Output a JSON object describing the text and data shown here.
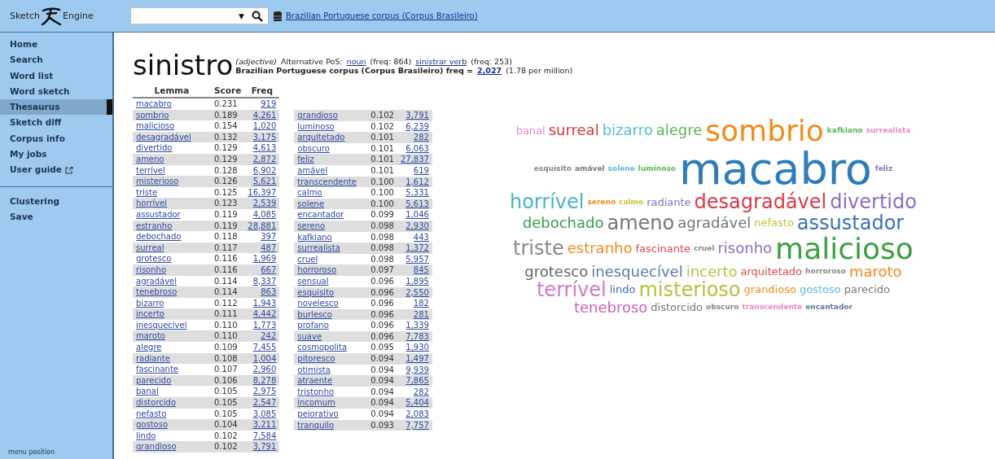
{
  "header": {
    "logo_left": "Sketch",
    "logo_right": "Engine",
    "search": {
      "dropdown": "▼"
    },
    "corpus_link": "Brazilian Portuguese corpus (Corpus Brasileiro)"
  },
  "sidebar": {
    "items": [
      {
        "label": "Home",
        "selected": false
      },
      {
        "label": "Search",
        "selected": false
      },
      {
        "label": "Word list",
        "selected": false
      },
      {
        "label": "Word sketch",
        "selected": false
      },
      {
        "label": "Thesaurus",
        "selected": true
      },
      {
        "label": "Sketch diff",
        "selected": false
      },
      {
        "label": "Corpus info",
        "selected": false
      },
      {
        "label": "My jobs",
        "selected": false
      },
      {
        "label": "User guide",
        "selected": false,
        "external": true
      }
    ],
    "tools": [
      "Clustering",
      "Save"
    ],
    "footer": "menu position"
  },
  "headword": {
    "word": "sinistro",
    "pos": "(adjective)",
    "alt_label": "Alternative PoS:",
    "alt": [
      {
        "link": "noun",
        "freq": "(freq: 864)"
      },
      {
        "link": "sinistrar verb",
        "freq": "(freq: 253)"
      }
    ],
    "corpus_text": "Brazilian Portuguese corpus (Corpus Brasileiro) freq =",
    "freq_link": "2,027",
    "per_million": "(1.78 per million)"
  },
  "table": {
    "columns": [
      "Lemma",
      "Score",
      "Freq"
    ],
    "rows": [
      [
        "macabro",
        "0.231",
        "919"
      ],
      [
        "sombrio",
        "0.189",
        "4,261"
      ],
      [
        "malicioso",
        "0.154",
        "1,020"
      ],
      [
        "desagradável",
        "0.132",
        "3,175"
      ],
      [
        "divertido",
        "0.129",
        "4,613"
      ],
      [
        "ameno",
        "0.129",
        "2,872"
      ],
      [
        "terrível",
        "0.128",
        "6,902"
      ],
      [
        "misterioso",
        "0.126",
        "5,621"
      ],
      [
        "triste",
        "0.125",
        "16,397"
      ],
      [
        "horrível",
        "0.123",
        "2,539"
      ],
      [
        "assustador",
        "0.119",
        "4,085"
      ],
      [
        "estranho",
        "0.119",
        "28,881"
      ],
      [
        "debochado",
        "0.118",
        "397"
      ],
      [
        "surreal",
        "0.117",
        "487"
      ],
      [
        "grotesco",
        "0.116",
        "1,969"
      ],
      [
        "risonho",
        "0.116",
        "667"
      ],
      [
        "agradável",
        "0.114",
        "8,337"
      ],
      [
        "tenebroso",
        "0.114",
        "863"
      ],
      [
        "bizarro",
        "0.112",
        "1,943"
      ],
      [
        "incerto",
        "0.111",
        "4,442"
      ],
      [
        "inesquecível",
        "0.110",
        "1,773"
      ],
      [
        "maroto",
        "0.110",
        "242"
      ],
      [
        "alegre",
        "0.109",
        "7,455"
      ],
      [
        "radiante",
        "0.108",
        "1,004"
      ],
      [
        "fascinante",
        "0.107",
        "2,960"
      ],
      [
        "parecido",
        "0.106",
        "8,278"
      ],
      [
        "banal",
        "0.105",
        "2,975"
      ],
      [
        "distorcido",
        "0.105",
        "2,547"
      ],
      [
        "nefasto",
        "0.105",
        "3,085"
      ],
      [
        "gostoso",
        "0.104",
        "3,211"
      ],
      [
        "lindo",
        "0.102",
        "7,584"
      ],
      [
        "grandioso",
        "0.102",
        "3,791"
      ]
    ],
    "rows_2": [
      [
        "grandioso",
        "0.102",
        "3,791"
      ],
      [
        "luminoso",
        "0.102",
        "6,239"
      ],
      [
        "arquitetado",
        "0.101",
        "282"
      ],
      [
        "obscuro",
        "0.101",
        "6,063"
      ],
      [
        "feliz",
        "0.101",
        "27,837"
      ],
      [
        "amável",
        "0.101",
        "619"
      ],
      [
        "transcendente",
        "0.100",
        "1,612"
      ],
      [
        "calmo",
        "0.100",
        "5,331"
      ],
      [
        "solene",
        "0.100",
        "5,613"
      ],
      [
        "encantador",
        "0.099",
        "1,046"
      ],
      [
        "sereno",
        "0.098",
        "2,930"
      ],
      [
        "kafkiano",
        "0.098",
        "443"
      ],
      [
        "surrealista",
        "0.098",
        "1,372"
      ],
      [
        "cruel",
        "0.098",
        "5,957"
      ],
      [
        "horroroso",
        "0.097",
        "845"
      ],
      [
        "sensual",
        "0.096",
        "1,895"
      ],
      [
        "esquisito",
        "0.096",
        "2,550"
      ],
      [
        "novelesco",
        "0.096",
        "182"
      ],
      [
        "burlesco",
        "0.096",
        "281"
      ],
      [
        "profano",
        "0.096",
        "1,339"
      ],
      [
        "suave",
        "0.096",
        "7,783"
      ],
      [
        "cosmopolita",
        "0.095",
        "1,930"
      ],
      [
        "pitoresco",
        "0.094",
        "1,497"
      ],
      [
        "otimista",
        "0.094",
        "9,939"
      ],
      [
        "atraente",
        "0.094",
        "7,865"
      ],
      [
        "tristonho",
        "0.094",
        "282"
      ],
      [
        "incomum",
        "0.094",
        "5,404"
      ],
      [
        "pejorativo",
        "0.094",
        "2,083"
      ],
      [
        "tranquilo",
        "0.093",
        "7,757"
      ]
    ]
  },
  "word_cloud": [
    {
      "text": "banal",
      "kind": "s",
      "color": "#e48bc0"
    },
    {
      "text": "surreal",
      "kind": "m",
      "color": "#d63a3a"
    },
    {
      "text": "bizarro",
      "kind": "m",
      "color": "#5bbcd6"
    },
    {
      "text": "alegre",
      "kind": "m",
      "color": "#5ab85a"
    },
    {
      "text": "sombrio",
      "kind": "xl",
      "color": "#f28a1e"
    },
    {
      "text": "kafkiano",
      "kind": "xs",
      "color": "#5ab85a"
    },
    {
      "text": "surrealista",
      "kind": "xs",
      "color": "#e48bc0"
    },
    {
      "text": "esquisito",
      "kind": "xs",
      "color": "#888888"
    },
    {
      "text": "amável",
      "kind": "xs",
      "color": "#777777"
    },
    {
      "text": "solene",
      "kind": "xs",
      "color": "#5bbcd6"
    },
    {
      "text": "luminoso",
      "kind": "xs",
      "color": "#5ab85a"
    },
    {
      "text": "macabro",
      "kind": "xxl",
      "color": "#2f7cb8"
    },
    {
      "text": "feliz",
      "kind": "xs",
      "color": "#8a6fbd"
    },
    {
      "text": "horrível",
      "kind": "l",
      "color": "#4ab4c4"
    },
    {
      "text": "sereno",
      "kind": "xs",
      "color": "#f28a1e"
    },
    {
      "text": "calmo",
      "kind": "xs",
      "color": "#c8c040"
    },
    {
      "text": "radiante",
      "kind": "s",
      "color": "#8a6fbd"
    },
    {
      "text": "desagradável",
      "kind": "l",
      "color": "#d63a4a"
    },
    {
      "text": "divertido",
      "kind": "l",
      "color": "#8e6cc0"
    },
    {
      "text": "debochado",
      "kind": "m",
      "color": "#3a9a4a"
    },
    {
      "text": "ameno",
      "kind": "l",
      "color": "#777777"
    },
    {
      "text": "agradável",
      "kind": "m",
      "color": "#777777"
    },
    {
      "text": "nefasto",
      "kind": "s",
      "color": "#c8c040"
    },
    {
      "text": "assustador",
      "kind": "l",
      "color": "#3b6fb6"
    },
    {
      "text": "triste",
      "kind": "l",
      "color": "#8a8a8a"
    },
    {
      "text": "estranho",
      "kind": "m",
      "color": "#f28a1e"
    },
    {
      "text": "fascinante",
      "kind": "s",
      "color": "#d64a4a"
    },
    {
      "text": "cruel",
      "kind": "xs",
      "color": "#888888"
    },
    {
      "text": "risonho",
      "kind": "m",
      "color": "#8a6fbd"
    },
    {
      "text": "malicioso",
      "kind": "xl",
      "color": "#3aa040"
    },
    {
      "text": "grotesco",
      "kind": "m",
      "color": "#666666"
    },
    {
      "text": "inesquecível",
      "kind": "m",
      "color": "#5a7aa8"
    },
    {
      "text": "incerto",
      "kind": "m",
      "color": "#bbc04a"
    },
    {
      "text": "arquitetado",
      "kind": "s",
      "color": "#d64a4a"
    },
    {
      "text": "horroroso",
      "kind": "xs",
      "color": "#888888"
    },
    {
      "text": "maroto",
      "kind": "m",
      "color": "#f28a1e"
    },
    {
      "text": "terrível",
      "kind": "l",
      "color": "#d47ac0"
    },
    {
      "text": "lindo",
      "kind": "s",
      "color": "#3b6fb6"
    },
    {
      "text": "misterioso",
      "kind": "l",
      "color": "#b8c040"
    },
    {
      "text": "grandioso",
      "kind": "s",
      "color": "#f28a1e"
    },
    {
      "text": "gostoso",
      "kind": "s",
      "color": "#5bbcd6"
    },
    {
      "text": "parecido",
      "kind": "s",
      "color": "#777777"
    },
    {
      "text": "tenebroso",
      "kind": "m",
      "color": "#d060b0"
    },
    {
      "text": "distorcido",
      "kind": "s",
      "color": "#777777"
    },
    {
      "text": "obscuro",
      "kind": "xs",
      "color": "#888888"
    },
    {
      "text": "transcendente",
      "kind": "xs",
      "color": "#e48bc0"
    },
    {
      "text": "encantador",
      "kind": "xs",
      "color": "#5a7aa8"
    }
  ]
}
